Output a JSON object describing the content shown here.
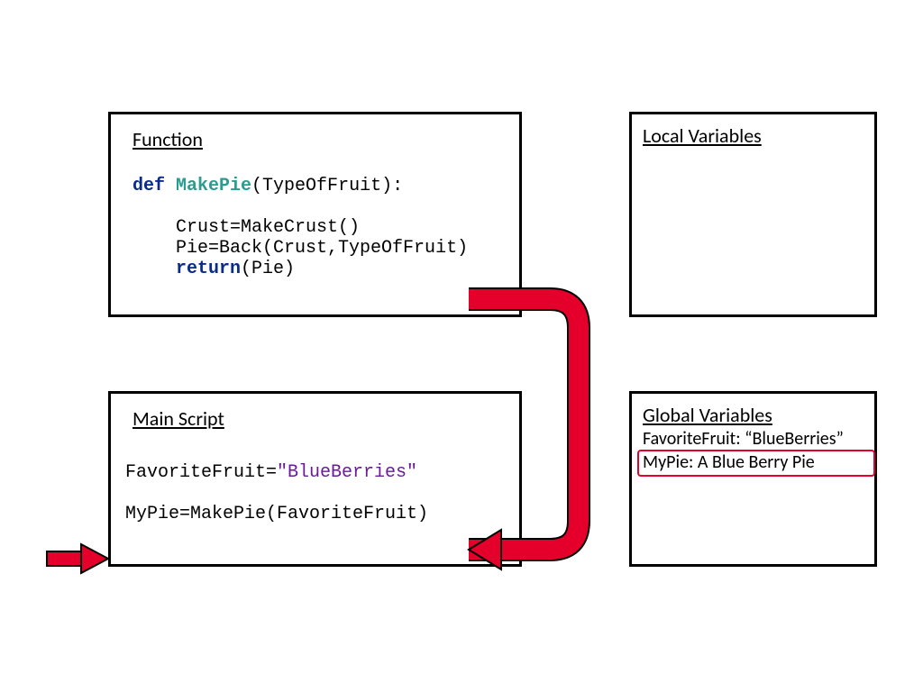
{
  "function_box": {
    "title": "Function",
    "code_def_kw": "def",
    "code_fn": "MakePie",
    "code_sig_rest": "(TypeOfFruit):",
    "code_line1": "Crust=MakeCrust()",
    "code_line2": "Pie=Back(Crust,TypeOfFruit)",
    "code_ret_kw": "return",
    "code_ret_rest": "(Pie)"
  },
  "main_box": {
    "title": "Main Script",
    "code_line1_lhs": "FavoriteFruit=",
    "code_line1_str": "\"BlueBerries\"",
    "code_line2": "MyPie=MakePie(FavoriteFruit)"
  },
  "local_box": {
    "title": "Local Variables"
  },
  "global_box": {
    "title": "Global Variables",
    "line1": "FavoriteFruit: “BlueBerries”",
    "line2": "MyPie: A Blue Berry Pie"
  }
}
